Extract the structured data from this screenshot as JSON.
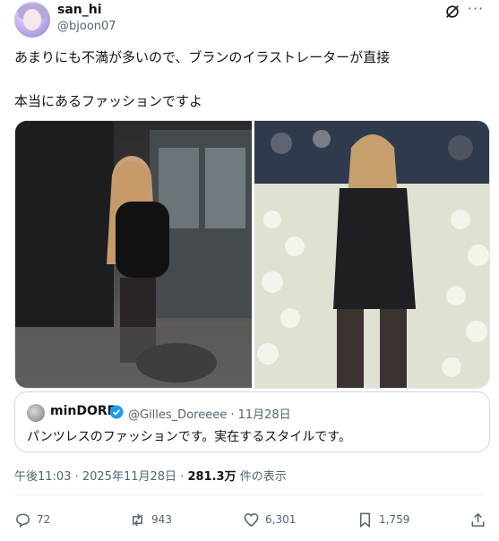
{
  "author": {
    "display_name": "san_hi",
    "handle": "@bjoon07"
  },
  "tweet": {
    "line1": "あまりにも不満が多いので、ブランのイラストレーターが直接",
    "line2": "本当にあるファッションですよ"
  },
  "media": {
    "left_image": "street-style-photo",
    "right_image": "red-carpet-photo"
  },
  "quote": {
    "name": "minDORE",
    "handle_date": "@Gilles_Doreeee · 11月28日",
    "text": "パンツレスのファッションです。実在するスタイルです。"
  },
  "meta": {
    "time_date": "午後11:03 · 2025年11月28日 · ",
    "views": "281.3万",
    "views_suffix": " 件の表示"
  },
  "actions": {
    "replies": "72",
    "reposts": "943",
    "likes": "6,301",
    "bookmarks": "1,759"
  },
  "colors": {
    "text": "#0f1419",
    "secondary": "#536471",
    "verified": "#1d9bf0"
  }
}
